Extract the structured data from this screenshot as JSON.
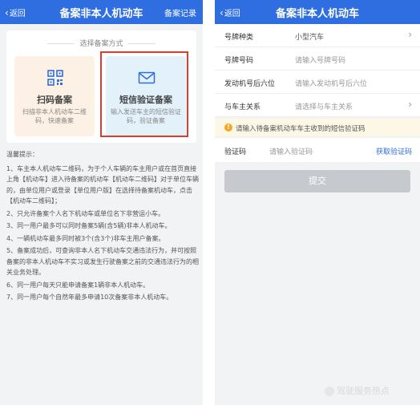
{
  "left": {
    "header": {
      "back": "返回",
      "title": "备案非本人机动车",
      "right_link": "备案记录"
    },
    "card": {
      "caption": "选择备案方式",
      "option1": {
        "name": "扫码备案",
        "desc": "扫描非本人机动车二维码，快速备案",
        "icon": "qr-code-icon"
      },
      "option2": {
        "name": "短信验证备案",
        "desc": "输入发送车主的短信验证码，验证备案",
        "icon": "envelope-icon"
      }
    },
    "notes": {
      "title": "温馨提示：",
      "items": [
        "1、车主本人机动车二维码，为于个人车辆的车主用户或在首页直接上角【机动车】进入待备案的机动车【机动车二维码】对于单位车辆的，由单位用户或登录【单位用户版】在选择待备案机动车，点击【机动车二维码】；",
        "2、只允许备案个人名下机动车或单位名下非营运小车。",
        "3、同一用户最多可以同时备案5辆(含5辆)非本人机动车。",
        "4、一辆机动车最多同时被3个(含3个)非车主用户备案。",
        "5、备案成功后，可查询非本人名下机动车交通违法行为，并可按照备案的非本人机动车不实习或发生行驶备案之前的交通违法行为的相关业务处理。",
        "6、同一用户每天只能申请备案1辆非本人机动车。",
        "7、同一用户每个自然年最多申请10次备案非本人机动车。"
      ]
    }
  },
  "right": {
    "header": {
      "back": "返回",
      "title": "备案非本人机动车"
    },
    "form": [
      {
        "label": "号牌种类",
        "value": "小型汽车",
        "placeholder": false,
        "arrow": true
      },
      {
        "label": "号牌号码",
        "value": "请输入号牌号码",
        "placeholder": true,
        "arrow": false
      },
      {
        "label": "发动机号后六位",
        "value": "请输入发动机号后六位",
        "placeholder": true,
        "arrow": false
      },
      {
        "label": "与车主关系",
        "value": "请选择与车主关系",
        "placeholder": true,
        "arrow": true
      }
    ],
    "warning": "请输入待备案机动车车主收到的短信验证码",
    "verify": {
      "label": "验证码",
      "placeholder": "请输入验证码",
      "get_code": "获取验证码"
    },
    "submit": "提交"
  },
  "watermark": "驾驶服务热点",
  "colors": {
    "primary": "#2e6ee0",
    "highlight_box": "#e33b2b",
    "warning_bg": "#fdf7e6",
    "warning_icon": "#f5a623"
  }
}
